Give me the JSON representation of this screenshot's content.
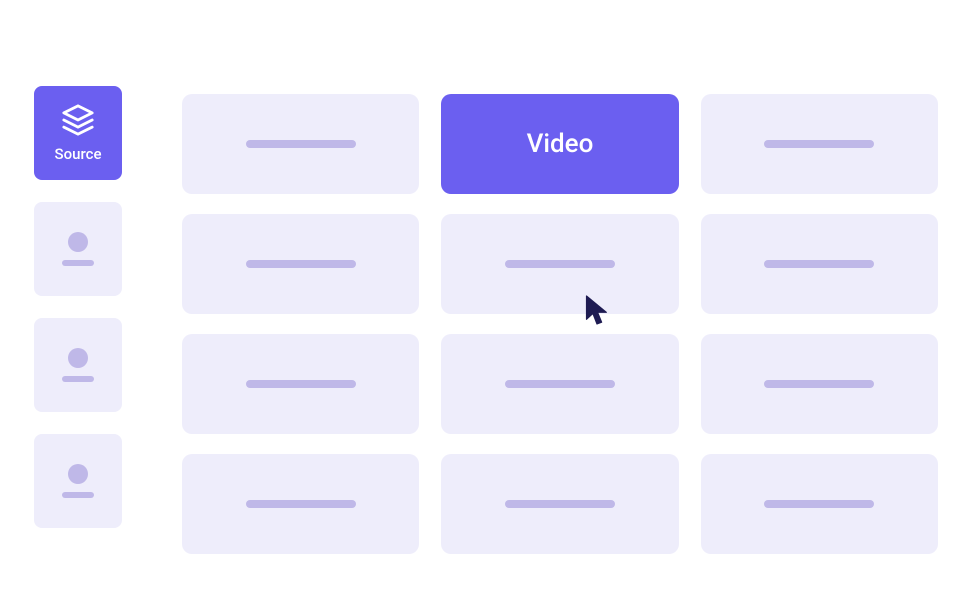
{
  "sidebar": {
    "active_label": "Source",
    "active_icon": "layers-icon",
    "accent_color": "#6b5ff0",
    "tile_bg": "#eeedfb",
    "placeholder_color": "#bfb8e8"
  },
  "grid": {
    "active_card_label": "Video"
  }
}
